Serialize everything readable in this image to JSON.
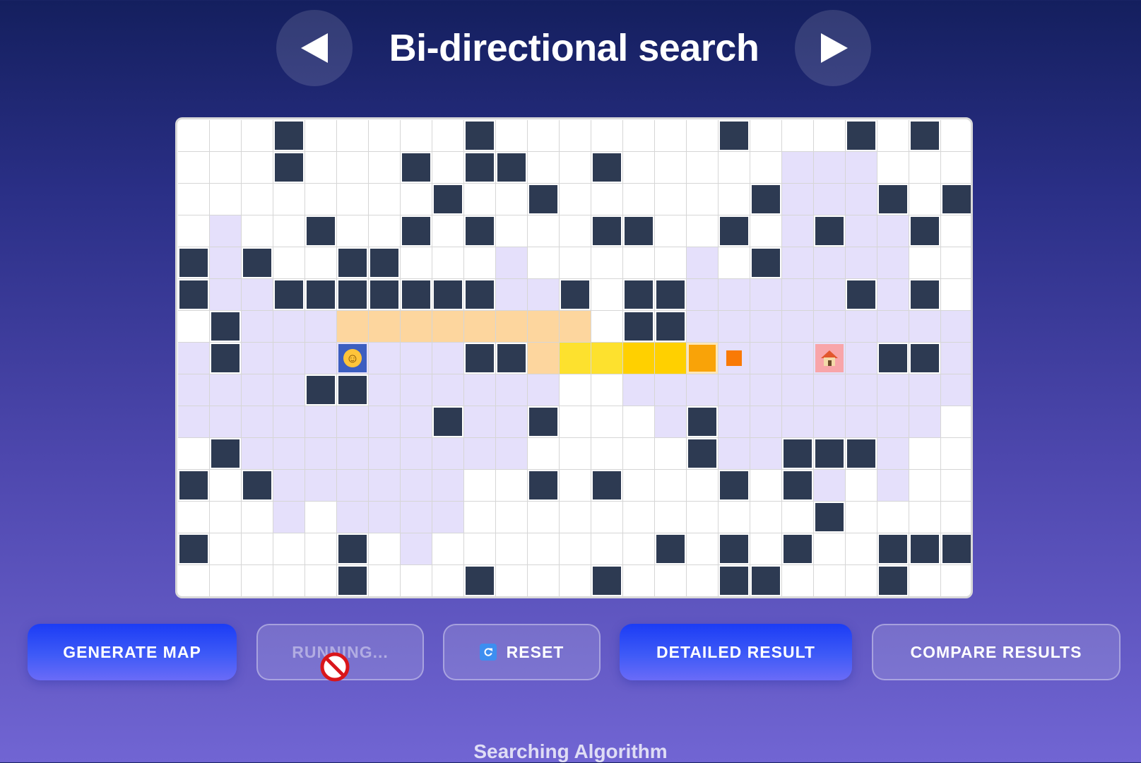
{
  "header": {
    "title": "Bi-directional search",
    "prev_icon": "triangle-left-icon",
    "next_icon": "triangle-right-icon"
  },
  "legend_colors": {
    "empty": "#ffffff",
    "wall": "#2d3a52",
    "visited": "#e5e0fb",
    "path": "#fdd69e",
    "path_bright": "#fde12e",
    "path_gold": "#ffd000",
    "frontier": "#f9a308",
    "current": "#f97a06",
    "start": "#3c5ec0",
    "goal": "#f8a5a9"
  },
  "grid": {
    "rows": 15,
    "cols": 25,
    "legend": "0=empty 1=wall 2=visited 3=path 4=path-bright 5=path-gold 6=frontier 7=current 8=start 9=goal",
    "cells": [
      "0001000001000000010001010",
      "0001000101100100000222000",
      "0000000010010000001222101",
      "0200100101000110010212210",
      "1210011000200000201222200",
      "1221111111221011222221210",
      "0122233333333011222222222",
      "2122282221134455672292112",
      "2222112222220022222222222",
      "2222222212210002122222220",
      "0122222222200000122111200",
      "1012222220010100010120200",
      "0002022220000000000010000",
      "1000010200000001010100111",
      "0000010001000100011000100"
    ]
  },
  "controls": {
    "generate_map": "GENERATE MAP",
    "running": "RUNNING...",
    "reset": "RESET",
    "detailed_result": "DETAILED RESULT",
    "compare_results": "COMPARE RESULTS",
    "running_disabled_icon": "no-entry-icon",
    "reset_icon": "refresh-icon"
  },
  "footer": {
    "section_title": "Searching Algorithm"
  }
}
